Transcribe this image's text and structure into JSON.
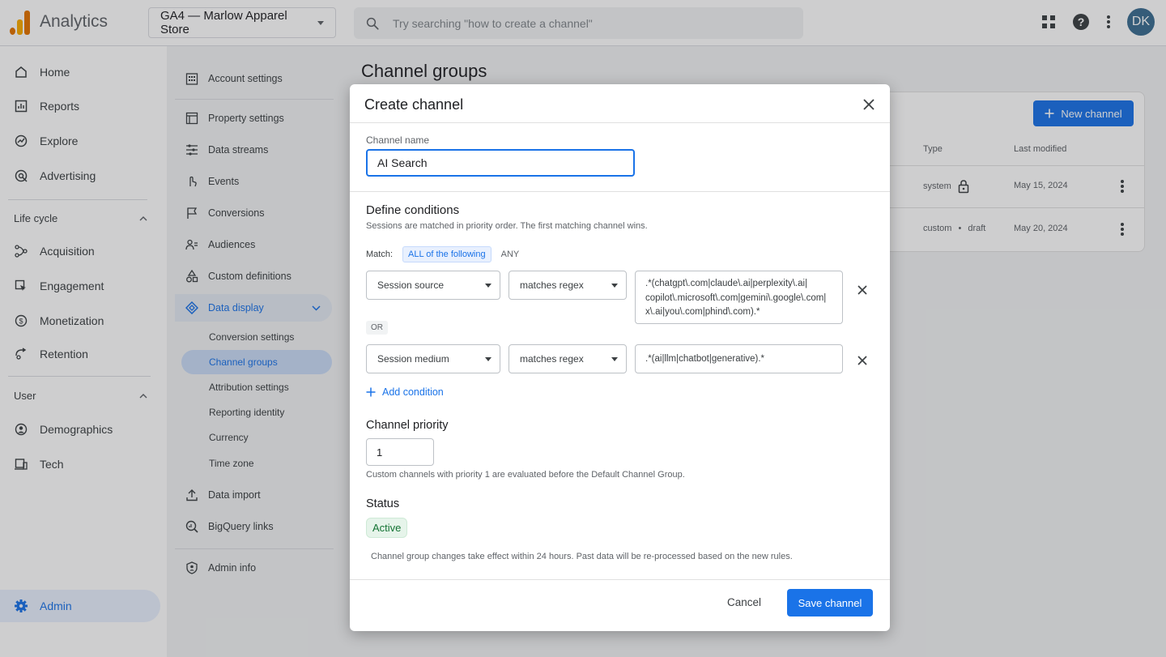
{
  "topbar": {
    "app_title": "Analytics",
    "property": "GA4 — Marlow Apparel Store",
    "search_placeholder": "Try searching \"how to create a channel\"",
    "avatar_initials": "DK"
  },
  "leftnav": {
    "main_items": [
      {
        "label": "Home",
        "icon": "home-icon"
      },
      {
        "label": "Reports",
        "icon": "reports-icon"
      },
      {
        "label": "Explore",
        "icon": "explore-icon"
      },
      {
        "label": "Advertising",
        "icon": "advertising-icon"
      }
    ],
    "lifecycle_label": "Life cycle",
    "lifecycle_items": [
      {
        "label": "Acquisition",
        "icon": "acquisition-icon"
      },
      {
        "label": "Engagement",
        "icon": "engagement-icon"
      },
      {
        "label": "Monetization",
        "icon": "monetization-icon"
      },
      {
        "label": "Retention",
        "icon": "retention-icon"
      }
    ],
    "user_label": "User",
    "user_items": [
      {
        "label": "Demographics",
        "icon": "demographics-icon"
      },
      {
        "label": "Tech",
        "icon": "tech-icon"
      }
    ],
    "admin_label": "Admin"
  },
  "admin": {
    "items": [
      "Account settings",
      "Property settings",
      "Data streams",
      "Events",
      "Conversions",
      "Audiences",
      "Custom definitions",
      "Data display"
    ],
    "sub_items": [
      "Conversion settings",
      "Channel groups",
      "Attribution settings",
      "Reporting identity",
      "Currency",
      "Time zone"
    ],
    "bottom_items": [
      "Data import",
      "BigQuery links",
      "Admin info"
    ]
  },
  "main": {
    "page_title": "Channel groups",
    "new_channel_label": "New channel",
    "col_type": "Type",
    "col_modified": "Last modified",
    "rows": [
      {
        "type": "system",
        "modified": "May 15, 2024"
      },
      {
        "type": "custom",
        "type_extra": "draft",
        "modified": "May 20, 2024"
      }
    ]
  },
  "dialog": {
    "title": "Create channel",
    "name_label": "Channel name",
    "name_value": "AI Search",
    "conditions_title": "Define conditions",
    "conditions_hint": "Sessions are matched in priority order. The first matching channel wins.",
    "match_label": "Match:",
    "match_all": "ALL of the following",
    "match_any": "ANY",
    "conditions": [
      {
        "dimension": "Session source",
        "operator": "matches regex",
        "value_lines": [
          ".*(chatgpt\\.com|claude\\.ai|perplexity\\.ai|",
          "copilot\\.microsoft\\.com|gemini\\.google\\.com|",
          "x\\.ai|you\\.com|phind\\.com).*"
        ]
      },
      {
        "dimension": "Session medium",
        "operator": "matches regex",
        "value_lines": [
          ".*(ai|llm|chatbot|generative).*"
        ]
      }
    ],
    "or_label": "OR",
    "add_condition": "Add condition",
    "priority_title": "Channel priority",
    "priority_value": "1",
    "priority_hint": "Custom channels with priority 1 are evaluated before the Default Channel Group.",
    "status_title": "Status",
    "status_value": "Active",
    "footer_note": "Channel group changes take effect within 24 hours. Past data will be re-processed based on the new rules.",
    "cancel_label": "Cancel",
    "save_label": "Save channel"
  },
  "colors": {
    "accent": "#1a73e8",
    "active_bg": "#e8f0fe",
    "status_green": "#137333",
    "logo_orange": "#e37400",
    "logo_yellow": "#f9ab00"
  }
}
